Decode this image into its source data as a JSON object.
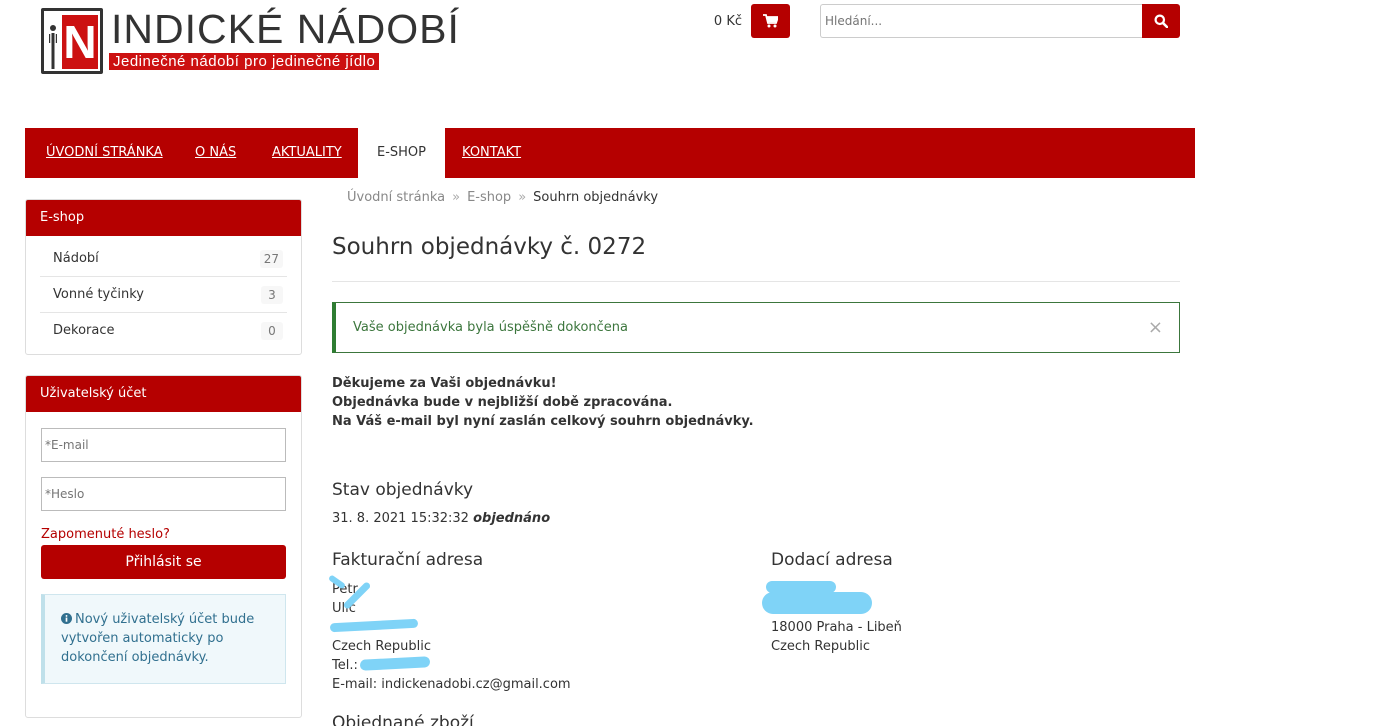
{
  "header": {
    "logo_letter_n": "N",
    "logo_title": "INDICKÉ NÁDOBÍ",
    "logo_tagline": "Jedinečné nádobí pro jedinečné jídlo",
    "cart_total": "0 Kč",
    "search_placeholder": "Hledání...",
    "icons": {
      "cart": "shopping-cart-icon",
      "search": "search-icon"
    },
    "colors": {
      "brand_red": "#b50000"
    }
  },
  "nav": {
    "items": [
      {
        "label": "ÚVODNÍ STRÁNKA"
      },
      {
        "label": "O NÁS"
      },
      {
        "label": "AKTUALITY"
      },
      {
        "label": "E-SHOP"
      },
      {
        "label": "KONTAKT"
      }
    ],
    "active": "E-SHOP"
  },
  "sidebar": {
    "eshop": {
      "title": "E-shop",
      "categories": [
        {
          "label": "Nádobí",
          "count": "27"
        },
        {
          "label": "Vonné tyčinky",
          "count": "3"
        },
        {
          "label": "Dekorace",
          "count": "0"
        }
      ]
    },
    "account": {
      "title": "Uživatelský účet",
      "email_placeholder": "*E-mail",
      "password_placeholder": "*Heslo",
      "forgot_label": "Zapomenuté heslo?",
      "login_label": "Přihlásit se",
      "info_text": "Nový uživatelský účet bude vytvořen automaticky po dokončení objednávky."
    }
  },
  "breadcrumb": {
    "items": [
      "Úvodní stránka",
      "E-shop",
      "Souhrn objednávky"
    ],
    "separator": "»"
  },
  "main": {
    "title": "Souhrn objednávky č. 0272",
    "alert": "Vaše objednávka byla úspěšně dokončena",
    "alert_close": "×",
    "thanks": [
      "Děkujeme za Vaši objednávku!",
      "Objednávka bude v nejbližší době zpracována.",
      "Na Váš e-mail byl nyní zaslán celkový souhrn objednávky."
    ],
    "status_heading": "Stav objednávky",
    "status_date": "31. 8. 2021 15:32:32",
    "status_value": "objednáno",
    "billing": {
      "heading": "Fakturační adresa",
      "lines": [
        "Petr",
        "Ulic",
        "",
        "Czech Republic",
        "Tel.:",
        "E-mail: indickenadobi.cz@gmail.com"
      ]
    },
    "shipping": {
      "heading": "Dodací adresa",
      "lines": [
        "",
        "",
        "18000 Praha - Libeň",
        "Czech Republic"
      ]
    },
    "ordered_heading": "Objednané zboží"
  }
}
